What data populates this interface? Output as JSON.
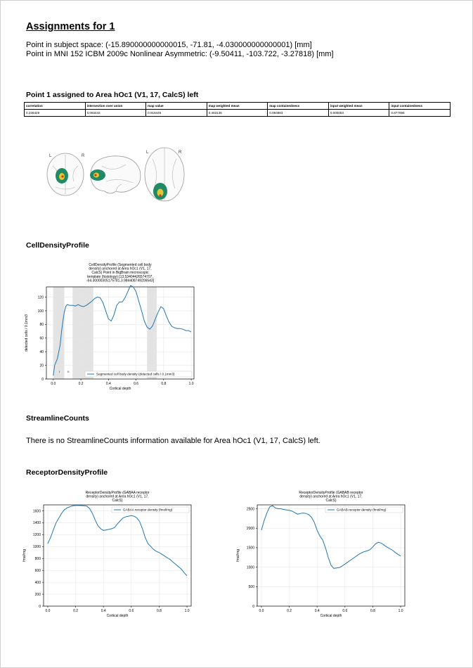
{
  "report": {
    "title": "Assignments for 1",
    "subject_point": "Point in subject space:  (-15.890000000000015, -71.81, -4.030000000000001) [mm]",
    "mni_point": "Point in MNI 152 ICBM 2009c Nonlinear Asymmetric: (-9.50411, -103.722, -3.27818) [mm]"
  },
  "assignment": {
    "heading": "Point 1 assigned to Area hOc1 (V1, 17, CalcS) left",
    "columns": [
      "correlation",
      "intersection over union",
      "map value",
      "map weighted mean",
      "map containedness",
      "input weighted mean",
      "input containedness"
    ],
    "rows": [
      [
        "0.236429",
        "0.093444",
        "0.916445",
        "0.463135",
        "0.094883",
        "0.000053",
        "0.877096"
      ]
    ]
  },
  "brain_figure": {
    "labels": [
      "L",
      "R",
      "L",
      "R"
    ],
    "colors": {
      "region": "#1f8a63",
      "core": "#e0c833",
      "marker": "#e0302a"
    }
  },
  "sections": {
    "cell_density": "CellDensityProfile",
    "streamline": "StreamlineCounts",
    "streamline_text": "There is no StreamlineCounts information available for Area hOc1 (V1, 17, CalcS) left.",
    "receptor": "ReceptorDensityProfile"
  },
  "chart_data": [
    {
      "type": "line",
      "title": "CellDensityProfile (Segmented cell body density) anchored at Area hOc1 (V1, 17, CalcS) Point in BigBrain microscopic template (histology) [13.53404426574707, -64.30000305175781,3.984408749206543]",
      "title_lines": [
        "CellDensityProfile (Segmented cell body",
        "density) anchored at Area hOc1 (V1, 17,",
        "CalcS) Point in BigBrain microscopic",
        "template (histology) [13.53404426574707,",
        "-64.30000305175781,3.984408749206543]"
      ],
      "xlabel": "Cortical depth",
      "ylabel": "detected cells / 0.1mm3",
      "xlim": [
        -0.05,
        1.02
      ],
      "ylim": [
        0,
        135
      ],
      "xticks": [
        0.0,
        0.2,
        0.4,
        0.6,
        0.8,
        1.0
      ],
      "xtick_labels": [
        "0.0",
        "0.2",
        "0.4",
        "0.6",
        "0.8",
        "1.0"
      ],
      "yticks": [
        0,
        20,
        40,
        60,
        80,
        100,
        120
      ],
      "ytick_labels": [
        "0",
        "20",
        "40",
        "60",
        "80",
        "100",
        "120"
      ],
      "grid": true,
      "legend": "lower right",
      "layer_bands": [
        [
          0.0,
          0.08
        ],
        [
          0.14,
          0.29
        ],
        [
          0.68,
          0.75
        ]
      ],
      "layer_labels": [
        {
          "x": 0.045,
          "text": "I"
        },
        {
          "x": 0.11,
          "text": "II"
        }
      ],
      "series": [
        {
          "name": "Segmented cell body density (detected cells / 0.1mm3)",
          "color": "#1f77b4",
          "x": [
            0.0,
            0.01,
            0.02,
            0.03,
            0.05,
            0.06,
            0.07,
            0.08,
            0.09,
            0.1,
            0.12,
            0.14,
            0.16,
            0.18,
            0.2,
            0.22,
            0.24,
            0.26,
            0.28,
            0.3,
            0.32,
            0.34,
            0.36,
            0.38,
            0.4,
            0.42,
            0.44,
            0.46,
            0.48,
            0.5,
            0.52,
            0.54,
            0.56,
            0.58,
            0.6,
            0.62,
            0.64,
            0.66,
            0.68,
            0.7,
            0.72,
            0.74,
            0.76,
            0.78,
            0.8,
            0.82,
            0.84,
            0.86,
            0.88,
            0.9,
            0.92,
            0.94,
            0.96,
            0.98,
            1.0
          ],
          "y": [
            5,
            20,
            25,
            30,
            50,
            70,
            85,
            98,
            106,
            109,
            108,
            108,
            107,
            109,
            107,
            106,
            108,
            111,
            114,
            118,
            120,
            119,
            112,
            100,
            88,
            85,
            94,
            108,
            113,
            113,
            119,
            128,
            137,
            135,
            128,
            114,
            100,
            85,
            76,
            73,
            78,
            88,
            98,
            106,
            103,
            92,
            83,
            77,
            75,
            74,
            74,
            73,
            71,
            71,
            69
          ]
        }
      ]
    },
    {
      "type": "line",
      "title": "ReceptorDensityProfile (GABAA receptor density) anchored at Area hOc1 (V1, 17, CalcS)",
      "title_lines": [
        "ReceptorDensityProfile (GABAA receptor",
        "density) anchored at Area hOc1 (V1, 17,",
        "CalcS)"
      ],
      "xlabel": "Cortical depth",
      "ylabel": "fmol/mg",
      "xlim": [
        -0.03,
        1.03
      ],
      "ylim": [
        0,
        1700
      ],
      "xticks": [
        0.0,
        0.2,
        0.4,
        0.6,
        0.8,
        1.0
      ],
      "xtick_labels": [
        "0.0",
        "0.2",
        "0.4",
        "0.6",
        "0.8",
        "1.0"
      ],
      "yticks": [
        0,
        200,
        400,
        600,
        800,
        1000,
        1200,
        1400,
        1600
      ],
      "ytick_labels": [
        "0",
        "200",
        "400",
        "600",
        "800",
        "1000",
        "1200",
        "1400",
        "1600"
      ],
      "grid": true,
      "legend": "upper right",
      "series": [
        {
          "name": "GABAA receptor density (fmol/mg)",
          "color": "#1f77b4",
          "x": [
            0.0,
            0.02,
            0.04,
            0.06,
            0.08,
            0.1,
            0.12,
            0.14,
            0.16,
            0.18,
            0.2,
            0.22,
            0.24,
            0.26,
            0.28,
            0.3,
            0.32,
            0.34,
            0.36,
            0.38,
            0.4,
            0.42,
            0.44,
            0.46,
            0.48,
            0.5,
            0.52,
            0.54,
            0.56,
            0.58,
            0.6,
            0.62,
            0.64,
            0.66,
            0.68,
            0.7,
            0.72,
            0.74,
            0.76,
            0.78,
            0.8,
            0.82,
            0.84,
            0.86,
            0.88,
            0.9,
            0.92,
            0.94,
            0.96,
            0.98,
            1.0
          ],
          "y": [
            1050,
            1150,
            1280,
            1400,
            1480,
            1560,
            1620,
            1650,
            1670,
            1685,
            1690,
            1690,
            1688,
            1685,
            1680,
            1640,
            1560,
            1450,
            1350,
            1300,
            1270,
            1280,
            1290,
            1300,
            1320,
            1380,
            1430,
            1480,
            1500,
            1510,
            1520,
            1510,
            1480,
            1420,
            1300,
            1150,
            1050,
            1000,
            950,
            920,
            900,
            870,
            840,
            810,
            780,
            740,
            700,
            660,
            620,
            560,
            510
          ]
        }
      ]
    },
    {
      "type": "line",
      "title": "ReceptorDensityProfile (GABAB receptor density) anchored at Area hOc1 (V1, 17, CalcS)",
      "title_lines": [
        "ReceptorDensityProfile (GABAB receptor",
        "density) anchored at Area hOc1 (V1, 17,",
        "CalcS)"
      ],
      "xlabel": "Cortical depth",
      "ylabel": "fmol/mg",
      "xlim": [
        -0.03,
        1.03
      ],
      "ylim": [
        0,
        2600
      ],
      "xticks": [
        0.0,
        0.2,
        0.4,
        0.6,
        0.8,
        1.0
      ],
      "xtick_labels": [
        "0.0",
        "0.2",
        "0.4",
        "0.6",
        "0.8",
        "1.0"
      ],
      "yticks": [
        0,
        500,
        1000,
        1500,
        2000,
        2500
      ],
      "ytick_labels": [
        "0",
        "500",
        "1000",
        "1500",
        "2000",
        "2500"
      ],
      "grid": true,
      "legend": "upper right",
      "series": [
        {
          "name": "GABAB receptor density (fmol/mg)",
          "color": "#1f77b4",
          "x": [
            0.0,
            0.02,
            0.04,
            0.06,
            0.08,
            0.1,
            0.12,
            0.14,
            0.16,
            0.18,
            0.2,
            0.22,
            0.24,
            0.26,
            0.28,
            0.3,
            0.32,
            0.34,
            0.36,
            0.38,
            0.4,
            0.42,
            0.44,
            0.46,
            0.48,
            0.5,
            0.52,
            0.54,
            0.56,
            0.58,
            0.6,
            0.62,
            0.64,
            0.66,
            0.68,
            0.7,
            0.72,
            0.74,
            0.76,
            0.78,
            0.8,
            0.82,
            0.84,
            0.86,
            0.88,
            0.9,
            0.92,
            0.94,
            0.96,
            0.98,
            1.0
          ],
          "y": [
            1950,
            2200,
            2400,
            2550,
            2580,
            2520,
            2500,
            2500,
            2480,
            2470,
            2460,
            2440,
            2400,
            2360,
            2380,
            2390,
            2380,
            2350,
            2280,
            2150,
            1950,
            1800,
            1700,
            1500,
            1250,
            1050,
            970,
            980,
            990,
            1030,
            1080,
            1130,
            1180,
            1230,
            1280,
            1330,
            1370,
            1400,
            1420,
            1450,
            1520,
            1600,
            1640,
            1620,
            1570,
            1520,
            1480,
            1440,
            1380,
            1330,
            1290
          ]
        }
      ]
    }
  ]
}
